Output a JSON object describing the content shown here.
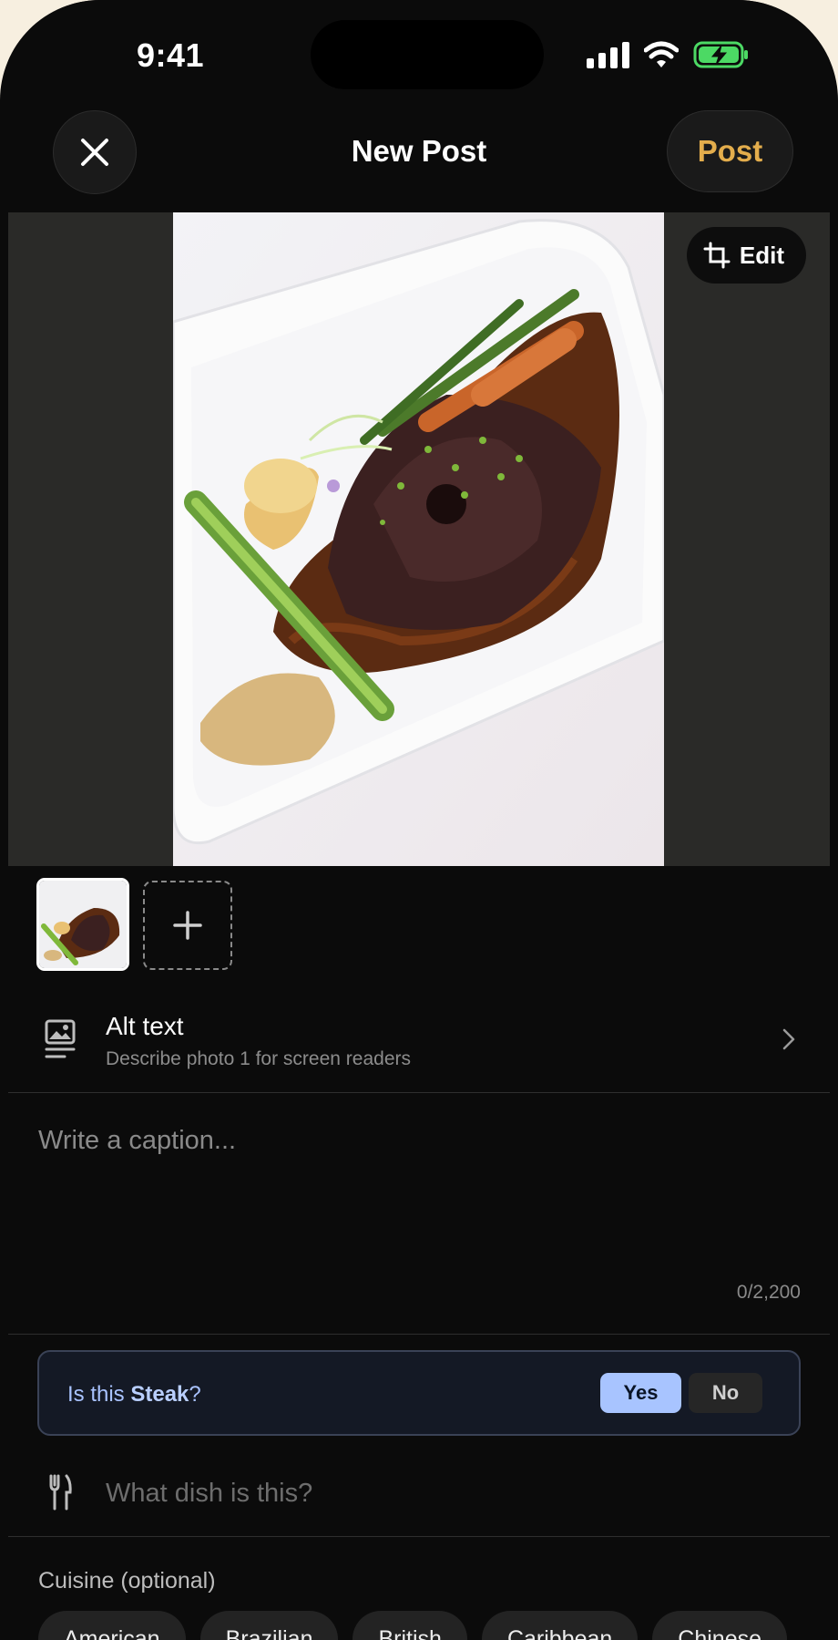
{
  "status_bar": {
    "time": "9:41"
  },
  "header": {
    "title": "New Post",
    "post_label": "Post"
  },
  "photo": {
    "edit_label": "Edit"
  },
  "alt_text": {
    "title": "Alt text",
    "subtitle": "Describe photo 1 for screen readers"
  },
  "caption": {
    "placeholder": "Write a caption...",
    "count": "0/2,200"
  },
  "suggestion": {
    "prefix": "Is this ",
    "dish": "Steak",
    "suffix": "?",
    "yes_label": "Yes",
    "no_label": "No"
  },
  "dish": {
    "placeholder": "What dish is this?"
  },
  "cuisine": {
    "label": "Cuisine (optional)",
    "options": [
      "American",
      "Brazilian",
      "British",
      "Caribbean",
      "Chinese"
    ]
  },
  "colors": {
    "accent": "#e3ad4c",
    "suggest_bg": "#141925",
    "yes_bg": "#a8c4ff",
    "battery": "#4cd964"
  }
}
